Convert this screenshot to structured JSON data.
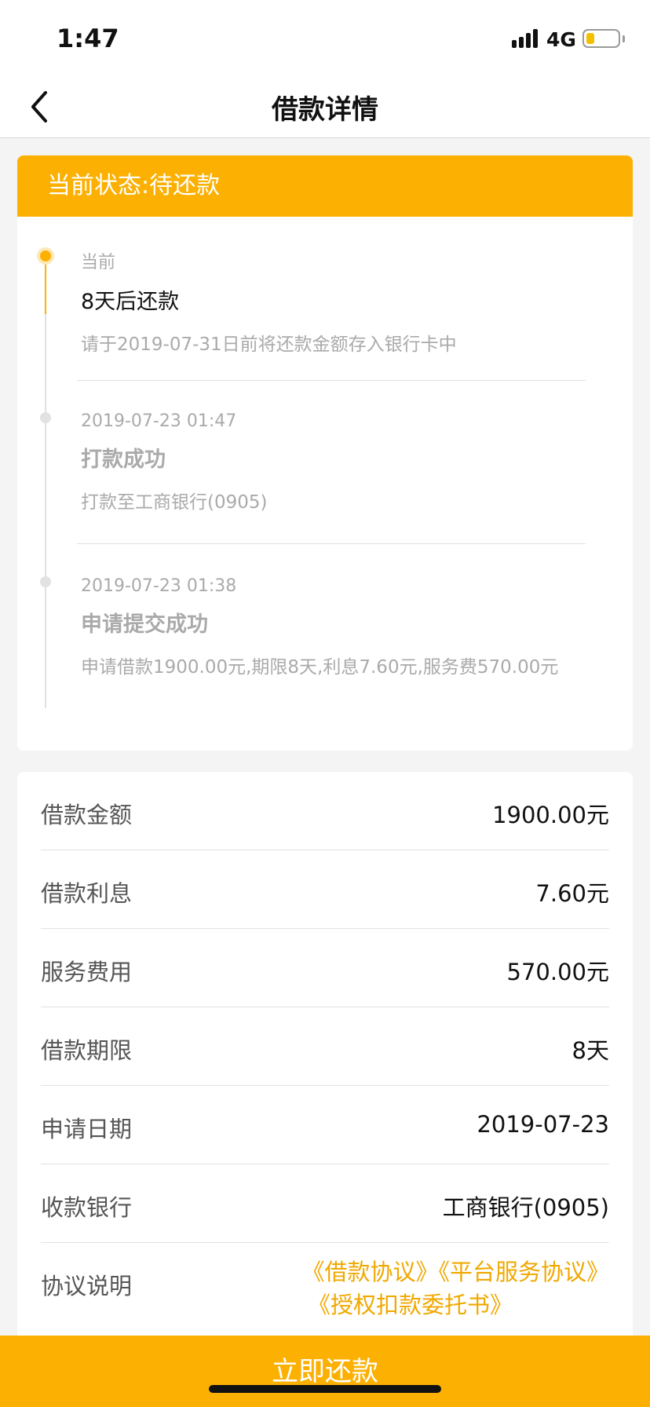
{
  "status_bar": {
    "time": "1:47",
    "network": "4G"
  },
  "nav": {
    "title": "借款详情",
    "back_icon": "chevron-left-icon"
  },
  "status_card": {
    "header": "当前状态:待还款",
    "events": [
      {
        "time": "当前",
        "title": "8天后还款",
        "desc": "请于2019-07-31日前将还款金额存入银行卡中"
      },
      {
        "time": "2019-07-23 01:47",
        "title": "打款成功",
        "desc": "打款至工商银行(0905)"
      },
      {
        "time": "2019-07-23 01:38",
        "title": "申请提交成功",
        "desc": "申请借款1900.00元,期限8天,利息7.60元,服务费570.00元"
      }
    ]
  },
  "details": {
    "rows": [
      {
        "label": "借款金额",
        "value": "1900.00元"
      },
      {
        "label": "借款利息",
        "value": "7.60元"
      },
      {
        "label": "服务费用",
        "value": "570.00元"
      },
      {
        "label": "借款期限",
        "value": "8天"
      },
      {
        "label": "申请日期",
        "value": "2019-07-23"
      },
      {
        "label": "收款银行",
        "value": "工商银行(0905)"
      }
    ],
    "agreement_label": "协议说明",
    "agreements": [
      "《借款协议》",
      "《平台服务协议》",
      "《授权扣款委托书》"
    ]
  },
  "repay_button": "立即还款",
  "colors": {
    "accent": "#fbb002",
    "link": "#f0a800"
  }
}
